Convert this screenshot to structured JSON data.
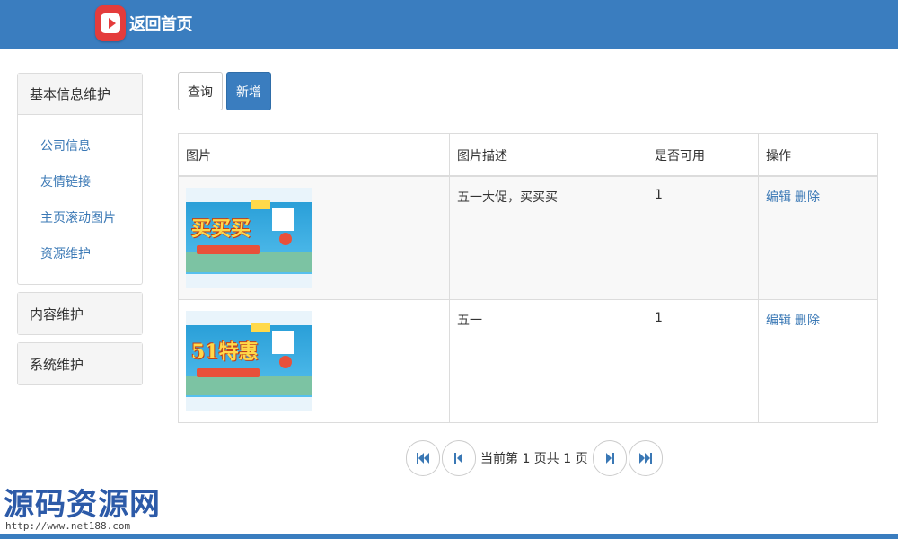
{
  "header": {
    "home_label": "返回首页",
    "home_icon": "play-icon",
    "bg_color": "#3a7dbf"
  },
  "sidebar": {
    "sections": [
      {
        "label": "基本信息维护",
        "expanded": true,
        "items": [
          {
            "label": "公司信息"
          },
          {
            "label": "友情链接"
          },
          {
            "label": "主页滚动图片"
          },
          {
            "label": "资源维护"
          }
        ]
      },
      {
        "label": "内容维护",
        "expanded": false
      },
      {
        "label": "系统维护",
        "expanded": false
      }
    ]
  },
  "toolbar": {
    "query_label": "查询",
    "add_label": "新增"
  },
  "table": {
    "columns": [
      "图片",
      "图片描述",
      "是否可用",
      "操作"
    ],
    "rows": [
      {
        "image_text": "买买买",
        "description": "五一大促，买买买",
        "enabled": "1",
        "edit": "编辑",
        "delete": "删除"
      },
      {
        "image_text": "51特惠",
        "description": "五一",
        "enabled": "1",
        "edit": "编辑",
        "delete": "删除"
      }
    ]
  },
  "pagination": {
    "info": "当前第 1 页共 1 页",
    "first_icon": "first-page-icon",
    "prev_icon": "prev-page-icon",
    "next_icon": "next-page-icon",
    "last_icon": "last-page-icon"
  },
  "watermark": {
    "title": "源码资源网",
    "url": "http://www.net188.com"
  }
}
